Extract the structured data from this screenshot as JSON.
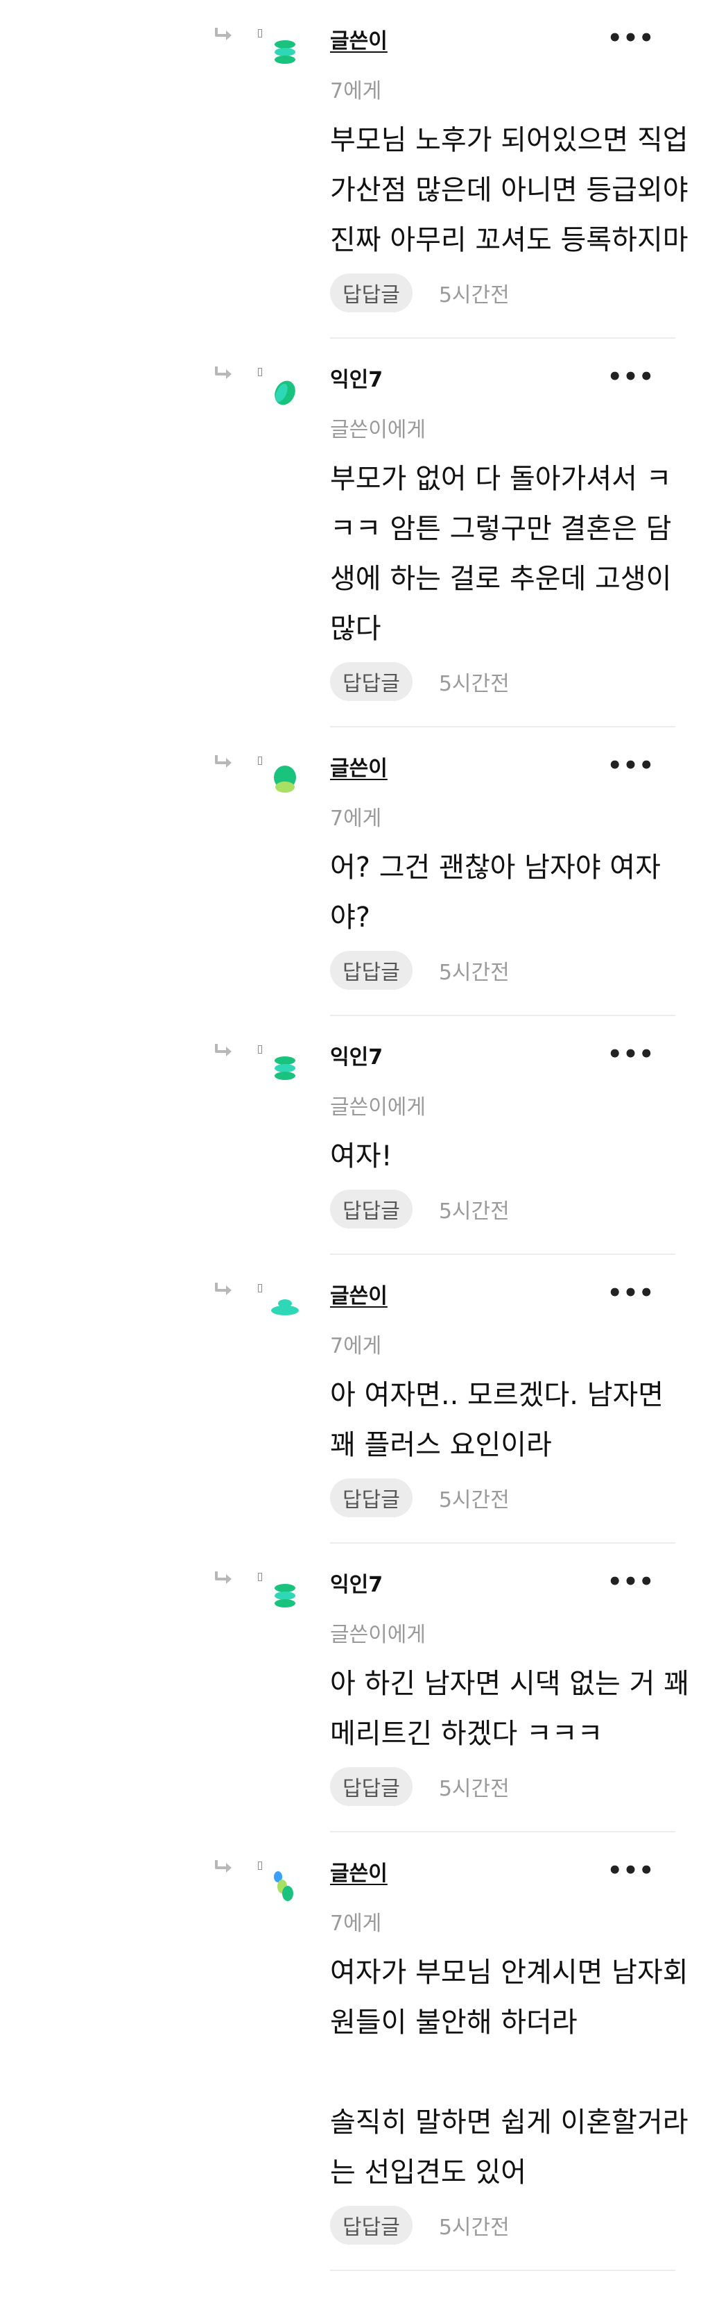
{
  "thread": {
    "replies": [
      {
        "author": "글쓴이",
        "is_writer": true,
        "recipient": "7에게",
        "lines": [
          "부모님 노후가 되어있으면 직업",
          "가산점 많은데 아니면 등급외야",
          "진짜 아무리 꼬셔도 등록하지마"
        ],
        "reply_label": "답답글",
        "time": "5시간전",
        "more_label": "•••"
      },
      {
        "author": "익인7",
        "is_writer": false,
        "recipient": "글쓴이에게",
        "lines": [
          "부모가 없어 다 돌아가셔서 ㅋ",
          "ㅋㅋ 암튼 그렇구만 결혼은 담",
          "생에 하는 걸로 추운데 고생이",
          "많다"
        ],
        "reply_label": "답답글",
        "time": "5시간전",
        "more_label": "•••"
      },
      {
        "author": "글쓴이",
        "is_writer": true,
        "recipient": "7에게",
        "lines": [
          "어? 그건 괜찮아 남자야 여자",
          "야?"
        ],
        "reply_label": "답답글",
        "time": "5시간전",
        "more_label": "•••"
      },
      {
        "author": "익인7",
        "is_writer": false,
        "recipient": "글쓴이에게",
        "lines": [
          "여자!"
        ],
        "reply_label": "답답글",
        "time": "5시간전",
        "more_label": "•••"
      },
      {
        "author": "글쓴이",
        "is_writer": true,
        "recipient": "7에게",
        "lines": [
          "아 여자면.. 모르겠다. 남자면",
          "꽤 플러스 요인이라"
        ],
        "reply_label": "답답글",
        "time": "5시간전",
        "more_label": "•••"
      },
      {
        "author": "익인7",
        "is_writer": false,
        "recipient": "글쓴이에게",
        "lines": [
          "아 하긴 남자면 시댁 없는 거 꽤",
          "메리트긴 하겠다 ㅋㅋㅋ"
        ],
        "reply_label": "답답글",
        "time": "5시간전",
        "more_label": "•••"
      },
      {
        "author": "글쓴이",
        "is_writer": true,
        "recipient": "7에게",
        "lines": [
          "여자가 부모님 안계시면 남자회",
          "원들이 불안해 하더라",
          "",
          "솔직히 말하면 쉽게 이혼할거라",
          "는 선입견도 있어"
        ],
        "reply_label": "답답글",
        "time": "5시간전",
        "more_label": "•••"
      }
    ]
  },
  "colors": {
    "avatar_green": "#19c37d",
    "avatar_teal": "#2ed8b6",
    "avatar_lime": "#a8e063",
    "avatar_blue": "#3aa0ff",
    "reply_button_bg": "#ececec",
    "muted_text": "#9a9a9a",
    "divider": "#ececec"
  },
  "icons": {
    "reply_arrow": "reply-arrow-icon",
    "more": "more-options-icon"
  }
}
